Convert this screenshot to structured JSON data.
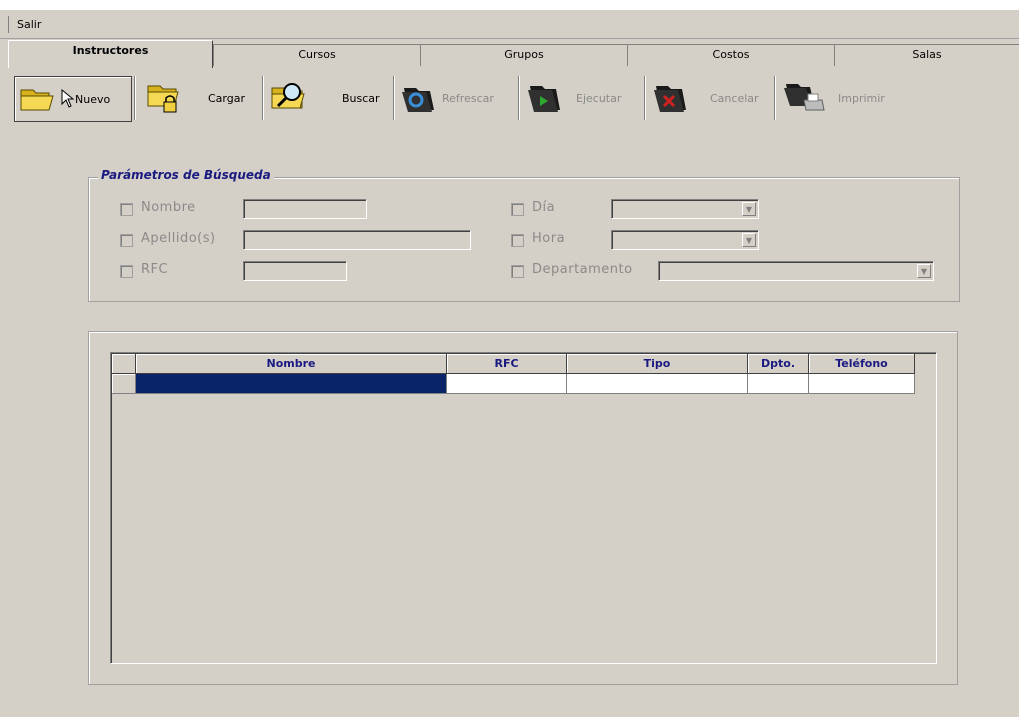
{
  "menu": {
    "salir": "Salir"
  },
  "tabs": [
    {
      "label": "Instructores",
      "active": true
    },
    {
      "label": "Cursos"
    },
    {
      "label": "Grupos"
    },
    {
      "label": "Costos"
    },
    {
      "label": "Salas"
    }
  ],
  "toolbar": {
    "nuevo": "Nuevo",
    "cargar": "Cargar",
    "buscar": "Buscar",
    "refrescar": "Refrescar",
    "ejecutar": "Ejecutar",
    "cancelar": "Cancelar",
    "imprimir": "Imprimir"
  },
  "search": {
    "title": "Parámetros de Búsqueda",
    "nombre": "Nombre",
    "apellidos": "Apellido(s)",
    "rfc": "RFC",
    "dia": "Día",
    "hora": "Hora",
    "departamento": "Departamento"
  },
  "grid": {
    "columns": [
      "Nombre",
      "RFC",
      "Tipo",
      "Dpto.",
      "Teléfono"
    ]
  },
  "colors": {
    "accent": "#0a246a",
    "label_blue": "#1a1a80",
    "face": "#d4d0c8"
  }
}
